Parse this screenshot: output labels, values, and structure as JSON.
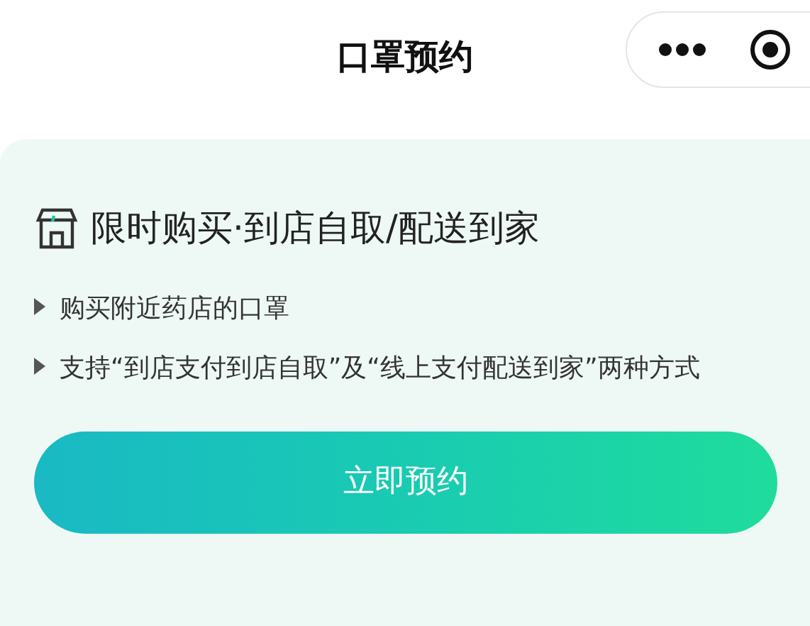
{
  "header": {
    "title": "口罩预约"
  },
  "card": {
    "heading": "限时购买·到店自取/配送到家",
    "bullets": [
      "购买附近药店的口罩",
      "支持“到店支付到店自取”及“线上支付配送到家”两种方式"
    ]
  },
  "button": {
    "label": "立即预约"
  }
}
